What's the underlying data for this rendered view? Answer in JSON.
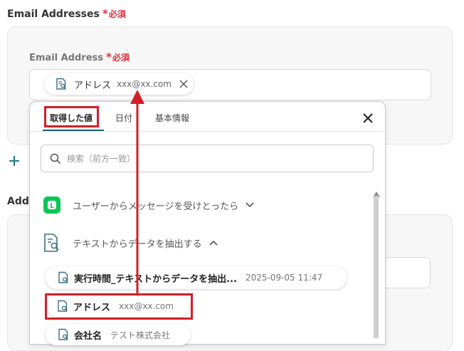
{
  "form": {
    "email_section_label": "Email Addresses",
    "required_mark": "*",
    "required_text": "必須",
    "email_field_label": "Email Address",
    "second_section_label": "Addr",
    "chip": {
      "label": "アドレス",
      "value": "xxx@xx.com"
    }
  },
  "dropdown": {
    "tabs": [
      {
        "label": "取得した値",
        "active": true
      },
      {
        "label": "日付",
        "active": false
      },
      {
        "label": "基本情報",
        "active": false
      }
    ],
    "search_placeholder": "検索（前方一致）",
    "groups": [
      {
        "label": "ユーザーからメッセージを受けとったら",
        "icon": "line-app-icon",
        "expanded": false
      },
      {
        "label": "テキストからデータを抽出する",
        "icon": "document-search-icon",
        "expanded": true
      }
    ],
    "items": [
      {
        "label": "実行時間_テキストからデータを抽出...",
        "value": "2025-09-05 11:47"
      },
      {
        "label": "アドレス",
        "value": "xxx@xx.com"
      },
      {
        "label": "会社名",
        "value": "テスト株式会社"
      }
    ]
  },
  "colors": {
    "required": "#e0303a",
    "highlight": "#d21f26",
    "accent": "#1e7f8c",
    "line_green": "#06c755"
  }
}
